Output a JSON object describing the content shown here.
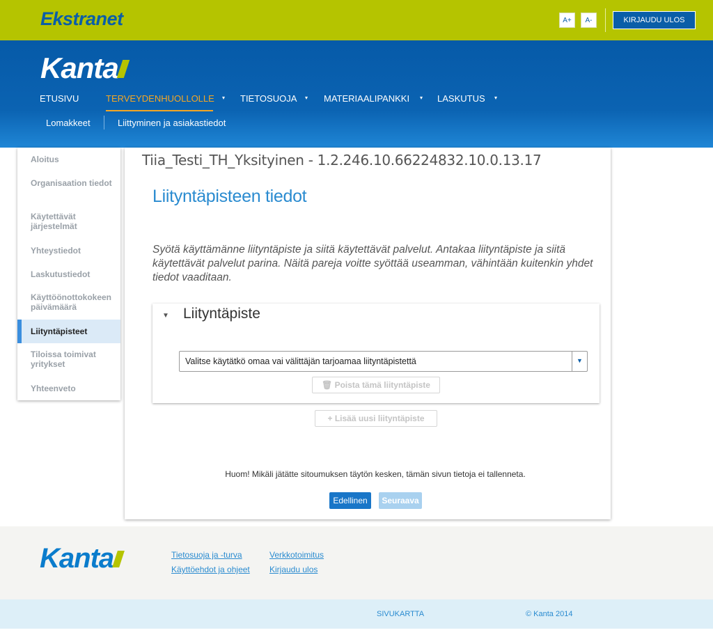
{
  "topbar": {
    "brand": "Ekstranet",
    "font_increase": "A+",
    "font_decrease": "A-",
    "logout": "KIRJAUDU ULOS"
  },
  "header": {
    "logo": "Kanta",
    "nav": [
      {
        "label": "ETUSIVU"
      },
      {
        "label": "TERVEYDENHUOLLOLLE",
        "active": true
      },
      {
        "label": "TIETOSUOJA"
      },
      {
        "label": "MATERIAALIPANKKI"
      },
      {
        "label": "LASKUTUS"
      }
    ],
    "subnav": [
      "Lomakkeet",
      "Liittyminen ja asiakastiedot"
    ]
  },
  "sidebar": {
    "items": [
      {
        "label": "Aloitus"
      },
      {
        "label": "Organisaation tiedot"
      },
      {
        "label": "Käytettävät järjestelmät"
      },
      {
        "label": "Yhteystiedot"
      },
      {
        "label": "Laskutustiedot"
      },
      {
        "label": "Käyttöönottokokeen päivämäärä"
      },
      {
        "label": "Liityntäpisteet",
        "active": true
      },
      {
        "label": "Tiloissa toimivat yritykset"
      },
      {
        "label": "Yhteenveto"
      }
    ]
  },
  "main": {
    "org_title": "Tiia_Testi_TH_Yksityinen - 1.2.246.10.66224832.10.0.13.17",
    "page_title": "Liityntäpisteen tiedot",
    "intro": "Syötä käyttämänne liityntäpiste ja siitä käytettävät palvelut. Antakaa liityntäpiste ja siitä käytettävät palvelut parina. Näitä pareja voitte syöttää useamman, vähintään kuitenkin yhdet tiedot vaaditaan.",
    "panel": {
      "title": "Liityntäpiste",
      "select_value": "Valitse käytätkö omaa vai välittäjän tarjoamaa liityntäpistettä",
      "remove_button": "Poista tämä liityntäpiste"
    },
    "add_button": "Lisää uusi liityntäpiste",
    "note": "Huom! Mikäli jätätte sitoumuksen täytön kesken, tämän sivun tietoja ei tallenneta.",
    "prev_button": "Edellinen",
    "next_button": "Seuraava"
  },
  "footer": {
    "logo": "Kanta",
    "links": [
      "Tietosuoja ja -turva",
      "Käyttöehdot ja ohjeet",
      "Verkkotoimitus",
      "Kirjaudu ulos"
    ],
    "sitemap": "SIVUKARTTA",
    "copyright": "© Kanta 2014"
  },
  "icons": {
    "caret": "caret-down-icon",
    "trash": "trash-icon",
    "plus": "plus-icon"
  },
  "colors": {
    "lime": "#b5c400",
    "blue": "#0a5ea8",
    "accent": "#2a8bd0",
    "active_nav": "#f5a623"
  }
}
